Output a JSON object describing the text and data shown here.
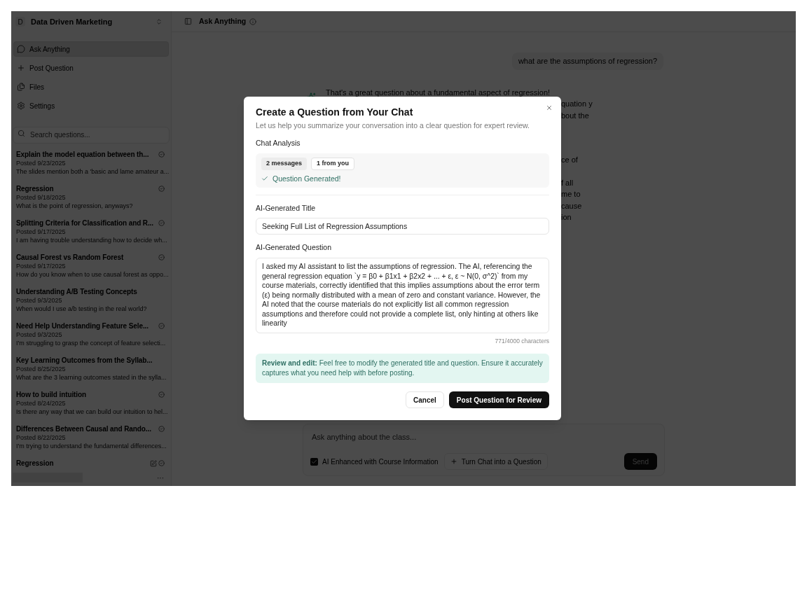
{
  "workspace": {
    "initial": "D",
    "name": "Data Driven Marketing"
  },
  "nav": [
    {
      "label": "Ask Anything",
      "kind": "chat",
      "selected": true
    },
    {
      "label": "Post Question",
      "kind": "plus",
      "selected": false
    },
    {
      "label": "Files",
      "kind": "files",
      "selected": false
    },
    {
      "label": "Settings",
      "kind": "settings",
      "selected": false
    }
  ],
  "search": {
    "placeholder": "Search questions..."
  },
  "questions": [
    {
      "title": "Explain the model equation between th...",
      "date": "Posted 9/23/2025",
      "preview": "The slides mention both a 'basic and lame amateur a...",
      "answered": true,
      "flagged": false
    },
    {
      "title": "Regression",
      "date": "Posted 9/18/2025",
      "preview": "What is the point of regression, anyways?",
      "answered": true,
      "flagged": false
    },
    {
      "title": "Splitting Criteria for Classification and R...",
      "date": "Posted 9/17/2025",
      "preview": "I am having trouble understanding how to decide wh...",
      "answered": true,
      "flagged": false
    },
    {
      "title": "Causal Forest vs Random Forest",
      "date": "Posted 9/17/2025",
      "preview": "How do you know when to use causal forest as oppo...",
      "answered": true,
      "flagged": false
    },
    {
      "title": "Understanding A/B Testing Concepts",
      "date": "Posted 9/3/2025",
      "preview": "When would I use a/b testing in the real world?",
      "answered": false,
      "flagged": false
    },
    {
      "title": "Need Help Understanding Feature Sele...",
      "date": "Posted 9/3/2025",
      "preview": "I'm struggling to grasp the concept of feature selecti...",
      "answered": true,
      "flagged": false
    },
    {
      "title": "Key Learning Outcomes from the Syllab...",
      "date": "Posted 8/25/2025",
      "preview": "What are the 3 learning outcomes stated in the sylla...",
      "answered": false,
      "flagged": false
    },
    {
      "title": "How to build intuition",
      "date": "Posted 8/24/2025",
      "preview": "Is there any way that we can build our intuition to hel...",
      "answered": true,
      "flagged": false
    },
    {
      "title": "Differences Between Causal and Rando...",
      "date": "Posted 8/22/2025",
      "preview": "I'm trying to understand the fundamental differences...",
      "answered": true,
      "flagged": false
    },
    {
      "title": "Regression",
      "answered": true,
      "flagged": true
    }
  ],
  "user_menu": {
    "more": "···"
  },
  "header": {
    "title": "Ask Anything"
  },
  "chat": {
    "user_message": "what are the assumptions of regression?",
    "assistant_first_line": "That's a great question about a fundamental aspect of regression!",
    "assistant_fragments": [
      [
        "quation y",
        "bout the"
      ],
      [
        "ce of"
      ],
      [
        "f all",
        "me to",
        "cause",
        "ion"
      ]
    ]
  },
  "composer": {
    "placeholder": "Ask anything about the class...",
    "ai_enhanced": {
      "label": "AI Enhanced with Course Information",
      "checked": true
    },
    "turn_button": "Turn Chat into a Question",
    "send": "Send"
  },
  "dialog": {
    "title": "Create a Question from Your Chat",
    "subtitle": "Let us help you summarize your conversation into a clear question for expert review.",
    "analysis_label": "Chat Analysis",
    "chips": [
      {
        "label": "2 messages",
        "kind": "filled"
      },
      {
        "label": "1 from you",
        "kind": "outline"
      }
    ],
    "status": "Question Generated!",
    "title_label": "AI-Generated Title",
    "title_value": "Seeking Full List of Regression Assumptions",
    "question_label": "AI-Generated Question",
    "question_value": "I asked my AI assistant to list the assumptions of regression. The AI, referencing the general regression equation `y = β0 + β1x1 + β2x2 + ... + ε, ε ~ N(0, σ^2)` from my course materials, correctly identified that this implies assumptions about the error term (ε) being normally distributed with a mean of zero and constant variance. However, the AI noted that the course materials do not explicitly list all common regression assumptions and therefore could not provide a complete list, only hinting at others like linearity",
    "char_count": "771/4000 characters",
    "note": "**Review and edit:** Feel free to modify the generated title and question. Ensure it accurately captures what you need help with before posting.",
    "cancel": "Cancel",
    "submit": "Post Question for Review"
  }
}
